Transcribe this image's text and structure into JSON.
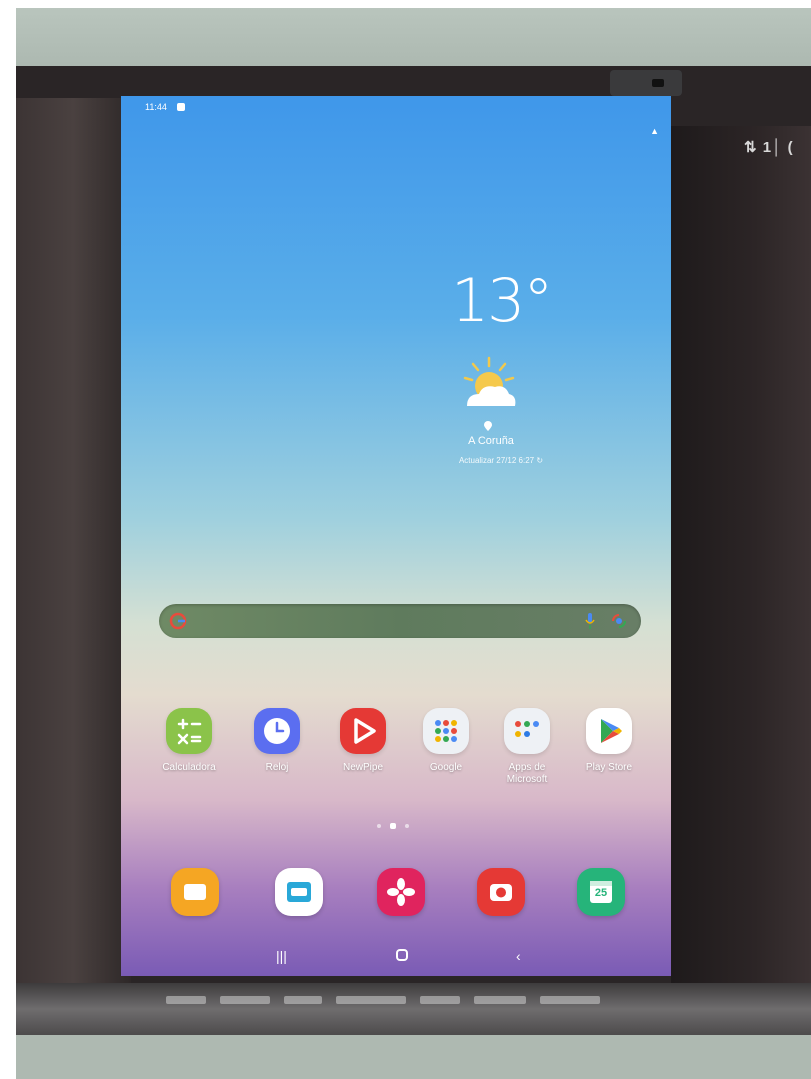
{
  "tablet": {
    "status_bar": {
      "time": "11:44"
    },
    "weather": {
      "temperature": "13°",
      "city": "A Coruña",
      "updated": "Actualizar 27/12 6:27"
    },
    "search": {
      "placeholder": ""
    },
    "apps": [
      {
        "label": "Calculadora",
        "icon": "calculator-icon"
      },
      {
        "label": "Reloj",
        "icon": "clock-icon"
      },
      {
        "label": "NewPipe",
        "icon": "newpipe-icon"
      },
      {
        "label": "Google",
        "icon": "google-folder-icon"
      },
      {
        "label": "Apps de Microsoft",
        "icon": "microsoft-folder-icon"
      },
      {
        "label": "Play Store",
        "icon": "play-store-icon"
      }
    ],
    "page_indicator": {
      "pages": 3,
      "current": 2
    },
    "dock": [
      {
        "icon": "files-icon"
      },
      {
        "icon": "file-manager-icon"
      },
      {
        "icon": "gallery-icon"
      },
      {
        "icon": "camera-icon"
      },
      {
        "icon": "calendar-icon",
        "text": "25"
      }
    ],
    "navigation": [
      "recent-apps",
      "home",
      "back"
    ]
  }
}
